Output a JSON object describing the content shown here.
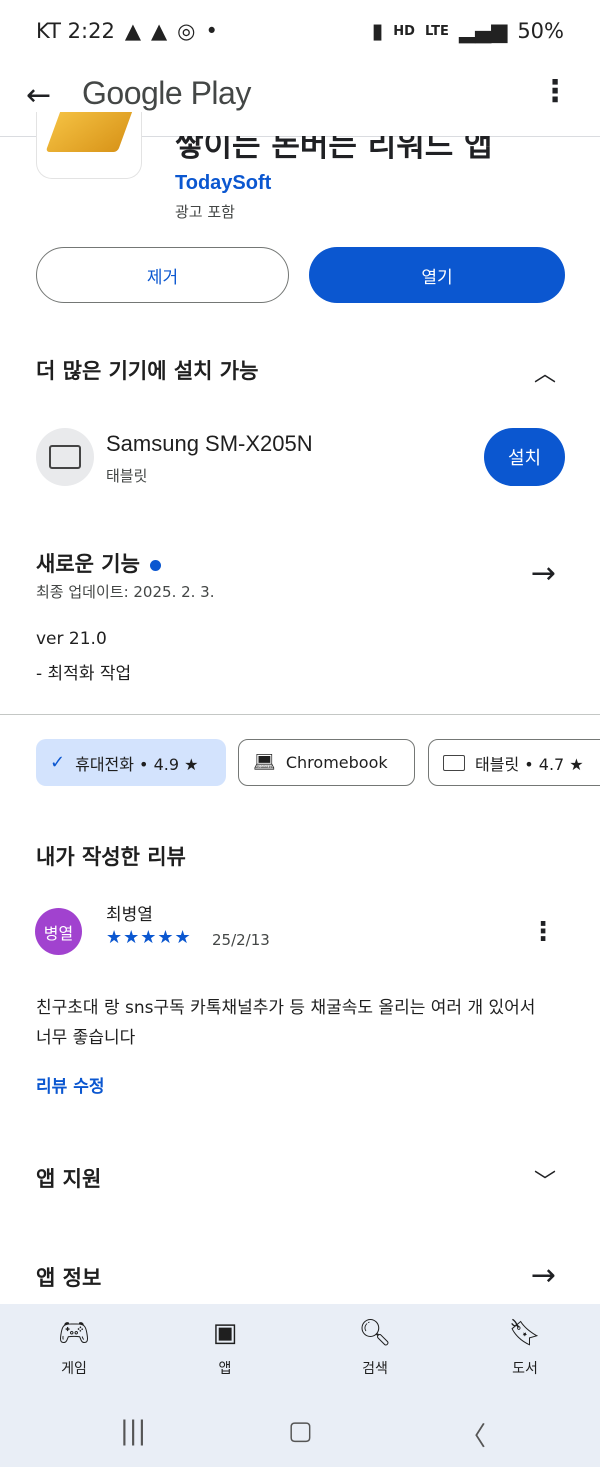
{
  "status": {
    "carrier_time": "KT 2:22",
    "icons_left": [
      "warning-icon",
      "warning-icon",
      "sync-icon",
      "dot-icon"
    ],
    "icons_right": [
      "battery-saver-icon",
      "hd-icon",
      "lte-icon",
      "signal-icon"
    ],
    "battery": "50%"
  },
  "appbar": {
    "title": "Google Play"
  },
  "app": {
    "name": "쌓이는 돈버는 리워드 앱",
    "developer": "TodaySoft",
    "ads_label": "광고 포함"
  },
  "actions": {
    "uninstall": "제거",
    "open": "열기"
  },
  "devices": {
    "heading": "더 많은 기기에 설치 가능",
    "device_name": "Samsung SM-X205N",
    "device_type": "태블릿",
    "install": "설치"
  },
  "whats_new": {
    "heading": "새로운 기능",
    "updated": "최종 업데이트: 2025. 2. 3.",
    "version": "ver 21.0",
    "notes": "- 최적화 작업"
  },
  "chips": [
    {
      "label": "휴대전화 • 4.9 ★",
      "icon": "check-icon"
    },
    {
      "label": "Chromebook",
      "icon": "laptop-icon"
    },
    {
      "label": "태블릿 • 4.7 ★",
      "icon": "tablet-icon"
    }
  ],
  "my_review": {
    "heading": "내가 작성한 리뷰",
    "avatar_text": "병열",
    "avatar_color": "#a142cf",
    "author": "최병열",
    "stars": "★★★★★",
    "date": "25/2/13",
    "text": "친구초대 랑 sns구독 카톡채널추가 등  채굴속도 올리는 여러 개 있어서 너무 좋습니다",
    "edit": "리뷰 수정"
  },
  "support": {
    "heading": "앱 지원"
  },
  "info": {
    "heading": "앱 정보"
  },
  "nav": [
    {
      "label": "게임",
      "icon": "gamepad-icon"
    },
    {
      "label": "앱",
      "icon": "apps-grid-icon"
    },
    {
      "label": "검색",
      "icon": "search-icon"
    },
    {
      "label": "도서",
      "icon": "book-icon"
    }
  ],
  "colors": {
    "accent": "#0b57d0",
    "chip_selected": "#d3e3fd",
    "nav_bg": "#e9eef6"
  }
}
